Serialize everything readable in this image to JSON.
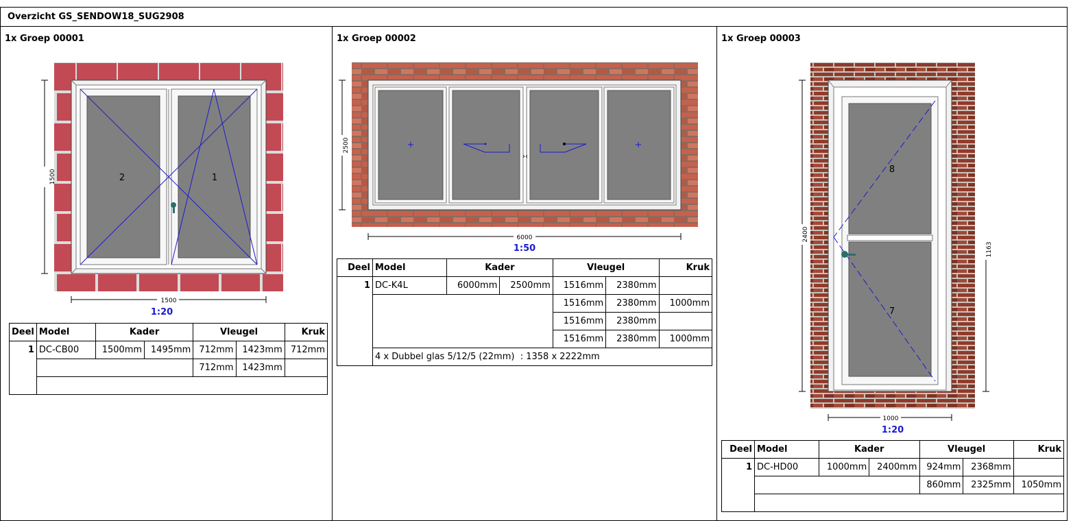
{
  "page": {
    "title": "Overzicht GS_SENDOW18_SUG2908"
  },
  "headers": {
    "deel": "Deel",
    "model": "Model",
    "kader": "Kader",
    "vleugel": "Vleugel",
    "kruk": "Kruk"
  },
  "groups": [
    {
      "title": "1x Groep 00001",
      "scale": "1:20",
      "dim_width": "1500",
      "dim_height": "1500",
      "sash_labels": [
        "2",
        "1"
      ],
      "rows": [
        {
          "deel": "1",
          "model": "DC-CB00",
          "kader_w": "1500mm",
          "kader_h": "1495mm",
          "vleugel_w": "712mm",
          "vleugel_h": "1423mm",
          "kruk": "712mm"
        },
        {
          "deel": "",
          "model": "",
          "kader_w": "",
          "kader_h": "",
          "vleugel_w": "712mm",
          "vleugel_h": "1423mm",
          "kruk": ""
        }
      ]
    },
    {
      "title": "1x Groep 00002",
      "scale": "1:50",
      "dim_width": "6000",
      "dim_height": "2500",
      "rows": [
        {
          "deel": "1",
          "model": "DC-K4L",
          "kader_w": "6000mm",
          "kader_h": "2500mm",
          "vleugel_w": "1516mm",
          "vleugel_h": "2380mm",
          "kruk": ""
        },
        {
          "vleugel_w": "1516mm",
          "vleugel_h": "2380mm",
          "kruk": "1000mm"
        },
        {
          "vleugel_w": "1516mm",
          "vleugel_h": "2380mm",
          "kruk": ""
        },
        {
          "vleugel_w": "1516mm",
          "vleugel_h": "2380mm",
          "kruk": "1000mm"
        }
      ],
      "glass_note": "4 x Dubbel glas 5/12/5 (22mm)  : 1358 x 2222mm"
    },
    {
      "title": "1x Groep 00003",
      "scale": "1:20",
      "dim_width": "1000",
      "dim_height": "2400",
      "dim_handle": "1163",
      "panel_labels": [
        "8",
        "7"
      ],
      "rows": [
        {
          "deel": "1",
          "model": "DC-HD00",
          "kader_w": "1000mm",
          "kader_h": "2400mm",
          "vleugel_w": "924mm",
          "vleugel_h": "2368mm",
          "kruk": ""
        },
        {
          "vleugel_w": "860mm",
          "vleugel_h": "2325mm",
          "kruk": "1050mm"
        }
      ]
    }
  ]
}
